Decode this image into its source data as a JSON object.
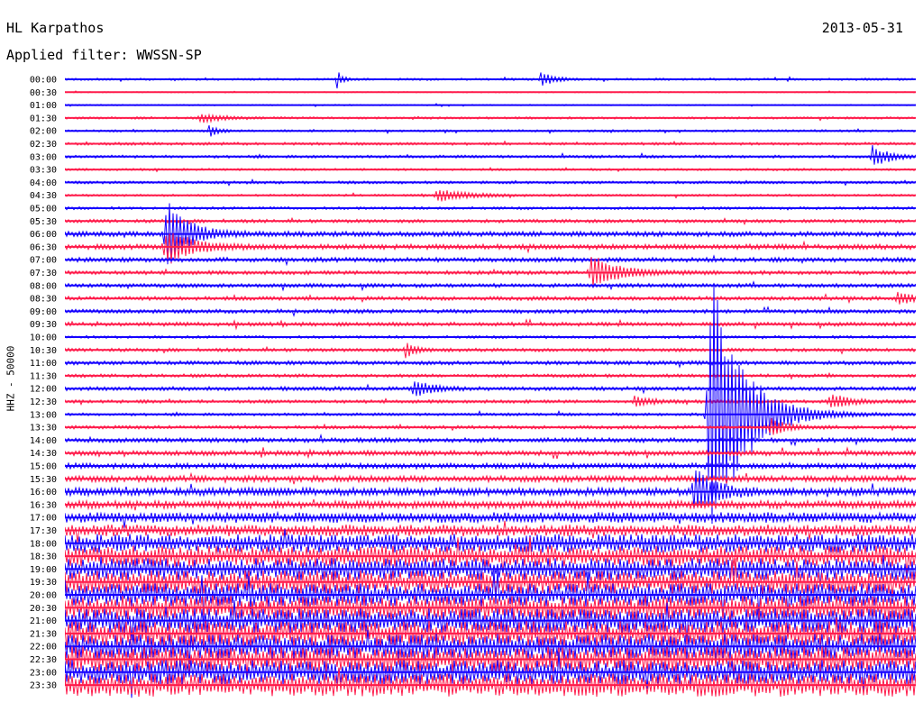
{
  "header": {
    "station": "HL Karpathos",
    "date": "2013-05-31",
    "filter": "Applied filter: WWSSN-SP"
  },
  "chart_data": {
    "type": "line",
    "title": "HL Karpathos",
    "subtitle": "Applied filter: WWSSN-SP",
    "date": "2013-05-31",
    "ylabel": "HHZ - 50000",
    "xlabel": "",
    "grid": false,
    "legend": "none",
    "colors": [
      "#1400ff",
      "#ff1a4a"
    ],
    "time_labels": [
      "00:00",
      "00:30",
      "01:00",
      "01:30",
      "02:00",
      "02:30",
      "03:00",
      "03:30",
      "04:00",
      "04:30",
      "05:00",
      "05:30",
      "06:00",
      "06:30",
      "07:00",
      "07:30",
      "08:00",
      "08:30",
      "09:00",
      "09:30",
      "10:00",
      "10:30",
      "11:00",
      "11:30",
      "12:00",
      "12:30",
      "13:00",
      "13:30",
      "14:00",
      "14:30",
      "15:00",
      "15:30",
      "16:00",
      "16:30",
      "17:00",
      "17:30",
      "18:00",
      "18:30",
      "19:00",
      "19:30",
      "20:00",
      "20:30",
      "21:00",
      "21:30",
      "22:00",
      "22:30",
      "23:00",
      "23:30"
    ],
    "trace_noise_level": [
      0.2,
      0.1,
      0.12,
      0.2,
      0.2,
      0.25,
      0.25,
      0.2,
      0.25,
      0.2,
      0.25,
      0.3,
      0.45,
      0.45,
      0.4,
      0.35,
      0.35,
      0.35,
      0.35,
      0.35,
      0.25,
      0.3,
      0.35,
      0.3,
      0.35,
      0.3,
      0.25,
      0.3,
      0.4,
      0.45,
      0.5,
      0.55,
      0.7,
      0.7,
      0.9,
      1.0,
      1.6,
      1.8,
      1.9,
      2.0,
      2.0,
      2.1,
      2.1,
      2.2,
      2.2,
      2.2,
      2.1,
      2.0
    ],
    "events": [
      {
        "trace": "00:00",
        "position": 0.32,
        "amplitude": 1.8,
        "width": 0.004
      },
      {
        "trace": "00:00",
        "position": 0.56,
        "amplitude": 1.2,
        "width": 0.012
      },
      {
        "trace": "01:30",
        "position": 0.16,
        "amplitude": 0.8,
        "width": 0.02
      },
      {
        "trace": "02:00",
        "position": 0.17,
        "amplitude": 1.0,
        "width": 0.008
      },
      {
        "trace": "03:00",
        "position": 0.95,
        "amplitude": 2.0,
        "width": 0.015
      },
      {
        "trace": "04:30",
        "position": 0.44,
        "amplitude": 1.0,
        "width": 0.03
      },
      {
        "trace": "06:00",
        "position": 0.12,
        "amplitude": 6.0,
        "width": 0.02
      },
      {
        "trace": "06:30",
        "position": 0.12,
        "amplitude": 3.0,
        "width": 0.025
      },
      {
        "trace": "07:30",
        "position": 0.62,
        "amplitude": 3.0,
        "width": 0.025
      },
      {
        "trace": "08:30",
        "position": 0.98,
        "amplitude": 1.0,
        "width": 0.02
      },
      {
        "trace": "10:30",
        "position": 0.4,
        "amplitude": 1.5,
        "width": 0.01
      },
      {
        "trace": "12:00",
        "position": 0.41,
        "amplitude": 1.5,
        "width": 0.015
      },
      {
        "trace": "12:30",
        "position": 0.67,
        "amplitude": 1.0,
        "width": 0.015
      },
      {
        "trace": "12:30",
        "position": 0.9,
        "amplitude": 1.2,
        "width": 0.02
      },
      {
        "trace": "13:00",
        "position": 0.76,
        "amplitude": 24.0,
        "width": 0.03
      },
      {
        "trace": "13:30",
        "position": 0.83,
        "amplitude": 1.5,
        "width": 0.015
      },
      {
        "trace": "16:00",
        "position": 0.74,
        "amplitude": 4.0,
        "width": 0.02
      }
    ]
  }
}
